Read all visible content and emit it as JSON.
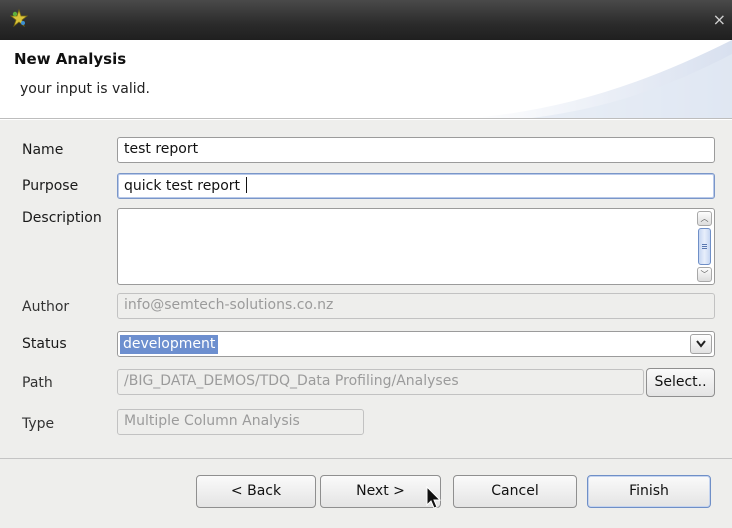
{
  "window": {
    "close_glyph": "×"
  },
  "header": {
    "title": "New Analysis",
    "message": "your input is valid."
  },
  "form": {
    "name": {
      "label": "Name",
      "value": "test report"
    },
    "purpose": {
      "label": "Purpose",
      "value": "quick test report "
    },
    "description": {
      "label": "Description",
      "value": ""
    },
    "author": {
      "label": "Author",
      "value": "info@semtech-solutions.co.nz"
    },
    "status": {
      "label": "Status",
      "value": "development"
    },
    "path": {
      "label": "Path",
      "value": "/BIG_DATA_DEMOS/TDQ_Data Profiling/Analyses",
      "select_label": "Select.."
    },
    "type": {
      "label": "Type",
      "value": "Multiple Column Analysis"
    }
  },
  "buttons": {
    "back": "< Back",
    "next": "Next >",
    "cancel": "Cancel",
    "finish": "Finish"
  },
  "icons": {
    "app": "puzzle-star-icon",
    "close": "close-icon",
    "dropdown": "chevron-down-icon",
    "cursor": "mouse-pointer-icon"
  },
  "colors": {
    "titlebar": "#2b2b2b",
    "selection": "#6d8fcf",
    "panel": "#eeeeec"
  }
}
